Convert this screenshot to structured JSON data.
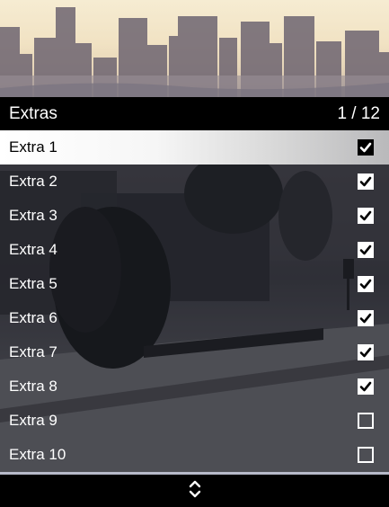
{
  "menu": {
    "title": "Extras",
    "counter": "1 / 12",
    "selected_index": 0,
    "items": [
      {
        "label": "Extra 1",
        "checked": true
      },
      {
        "label": "Extra 2",
        "checked": true
      },
      {
        "label": "Extra 3",
        "checked": true
      },
      {
        "label": "Extra 4",
        "checked": true
      },
      {
        "label": "Extra 5",
        "checked": true
      },
      {
        "label": "Extra 6",
        "checked": true
      },
      {
        "label": "Extra 7",
        "checked": true
      },
      {
        "label": "Extra 8",
        "checked": true
      },
      {
        "label": "Extra 9",
        "checked": false
      },
      {
        "label": "Extra 10",
        "checked": false
      }
    ]
  },
  "icons": {
    "footer": "up-down-arrows-icon",
    "check": "checkmark-icon"
  },
  "colors": {
    "header_bg": "#000000",
    "selected_row": "#ffffff",
    "text": "#ffffff",
    "divider": "#b7bac9"
  }
}
